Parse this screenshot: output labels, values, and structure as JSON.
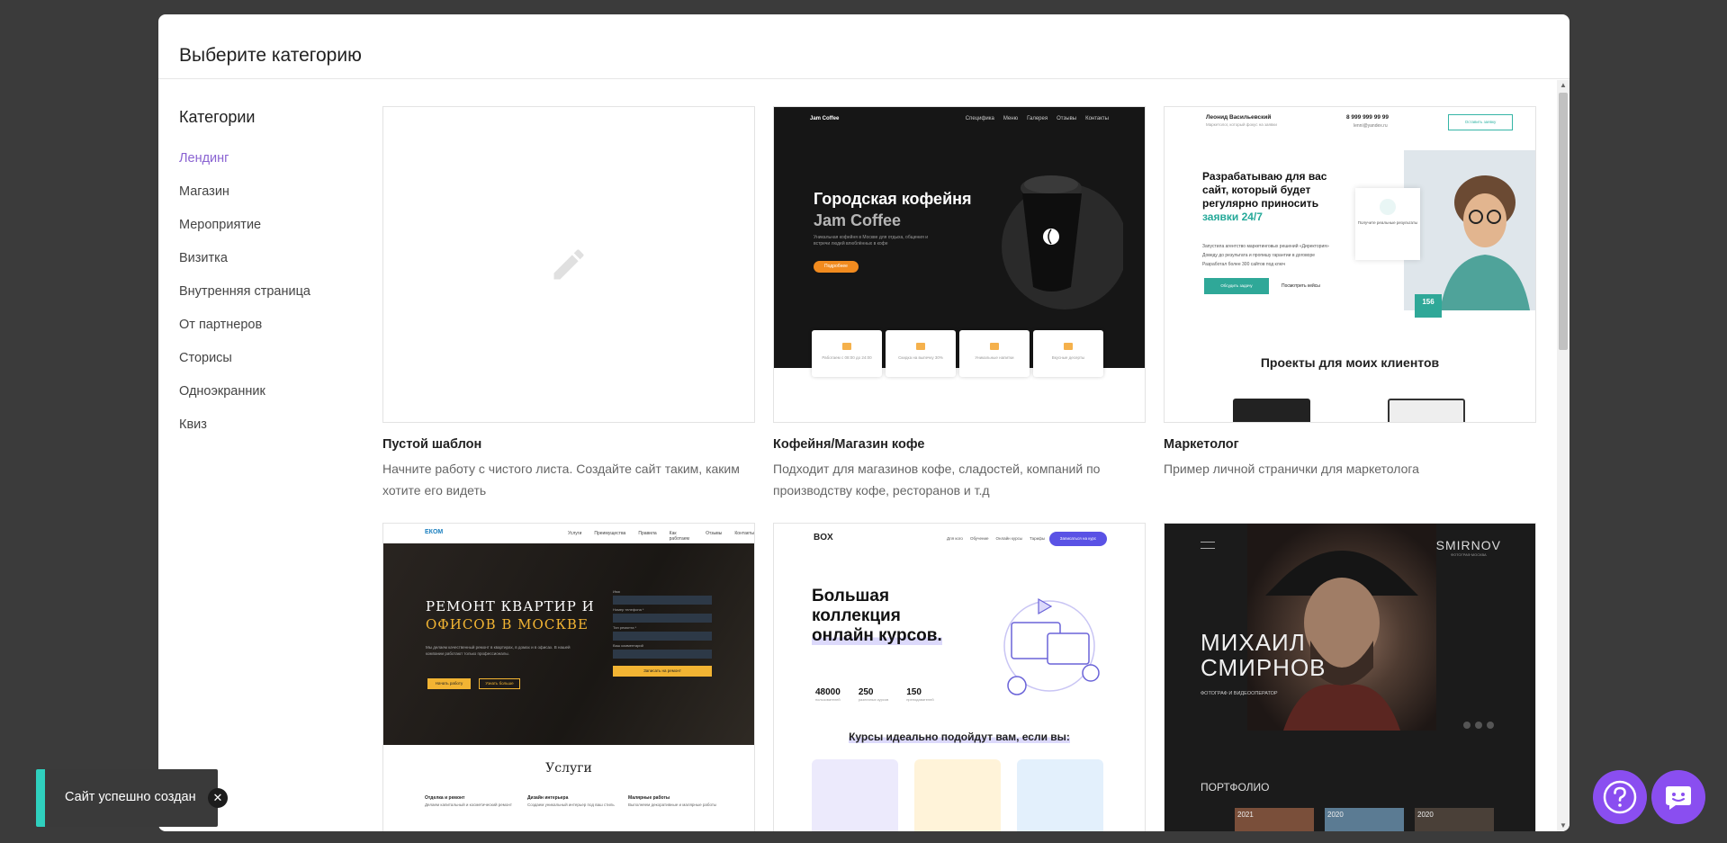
{
  "modal": {
    "title": "Выберите категорию"
  },
  "sidebar": {
    "title": "Категории",
    "items": [
      {
        "label": "Лендинг",
        "active": true
      },
      {
        "label": "Магазин"
      },
      {
        "label": "Мероприятие"
      },
      {
        "label": "Визитка"
      },
      {
        "label": "Внутренняя страница"
      },
      {
        "label": "От партнеров"
      },
      {
        "label": "Сторисы"
      },
      {
        "label": "Одноэкранник"
      },
      {
        "label": "Квиз"
      }
    ]
  },
  "templates": [
    {
      "name": "Пустой шаблон",
      "description": "Начните работу с чистого листа. Создайте сайт таким, каким хотите его видеть",
      "icon": "pencil-icon"
    },
    {
      "name": "Кофейня/Магазин кофе",
      "description": "Подходит для магазинов кофе, сладостей, компаний по производству кофе, ресторанов и т.д",
      "preview": {
        "brand": "Jam Coffee",
        "nav": [
          "Jam Coffee",
          "Специфика",
          "Меню",
          "Галерея",
          "Отзывы",
          "Контакты"
        ],
        "headline": "Городская кофейня",
        "headline_sub": "Jam Coffee",
        "lead": "Уникальная кофейня в Москве для отдыха, общения и встречи людей влюблённых в кофе",
        "button": "Подробнее",
        "features": [
          "Работаем с 08:00 до 24:00",
          "Скидка на выпечку 30%",
          "Уникальные напитки",
          "Вкусные десерты"
        ]
      }
    },
    {
      "name": "Маркетолог",
      "description": "Пример личной странички для маркетолога",
      "preview": {
        "person": "Леонид Васильевский",
        "tagline": "Маркетолог, который фокус на заявки",
        "phone": "8 999 999 99 99",
        "email": "lenni@yandex.ru",
        "cta": "Оставить заявку",
        "headline_1": "Разрабатываю для вас сайт, который будет регулярно приносить",
        "headline_2": "заявки 24/7",
        "bullets": [
          "Запустила агентство маркетинговых решений «Директория»",
          "Доведу до результата и пропишу гарантии в договоре",
          "Разработал более 300 сайтов под ключ"
        ],
        "button": "Обсудить задачу",
        "link": "Посмотреть кейсы",
        "card": "Получите реальные результаты",
        "badge": "156",
        "section": "Проекты для моих клиентов"
      }
    },
    {
      "name": "",
      "description": "",
      "preview": {
        "logo": "ЕКОМ",
        "nav": [
          "Услуги",
          "Преимущества",
          "Правила",
          "Как работаем",
          "Отзывы",
          "Контакты"
        ],
        "headline_1": "РЕМОНТ КВАРТИР И",
        "headline_2": "ОФИСОВ В МОСКВЕ",
        "lead": "Мы делаем качественный ремонт в квартирах, в домах и в офисах. В нашей компании работают только профессионалы.",
        "button_1": "Начать работу",
        "button_2": "Узнать больше",
        "form_labels": [
          "Имя",
          "Номер телефона *",
          "Тип ремонта *",
          "Ваш комментарий"
        ],
        "form_button": "Записать на ремонт",
        "section": "Услуги",
        "services": [
          {
            "title": "Отделка и ремонт",
            "text": "Делаем капитальный и косметический ремонт"
          },
          {
            "title": "Дизайн интерьера",
            "text": "Создаем уникальный интерьер под ваш стиль"
          },
          {
            "title": "Малярные работы",
            "text": "Выполняем декоративные и малярные работы"
          }
        ]
      }
    },
    {
      "name": "",
      "description": "",
      "preview": {
        "logo": "BOX",
        "nav": [
          "Для кого",
          "Обучение",
          "Онлайн курсы",
          "Тарифы"
        ],
        "nav_button": "Записаться на курс",
        "headline_1": "Большая",
        "headline_2": "коллекция",
        "headline_3": "онлайн курсов.",
        "stats": [
          {
            "value": "48000",
            "label": "пользователей"
          },
          {
            "value": "250",
            "label": "различных курсов"
          },
          {
            "value": "150",
            "label": "преподавателей"
          }
        ],
        "section": "Курсы идеально подойдут вам, если вы:"
      }
    },
    {
      "name": "",
      "description": "",
      "preview": {
        "brand": "SMIRNOV",
        "brand_sub": "ФОТОГРАФ МОСКВА",
        "headline_1": "МИХАИЛ",
        "headline_2": "СМИРНОВ",
        "sub": "ФОТОГРАФ И ВИДЕООПЕРАТОР",
        "section": "ПОРТФОЛИО",
        "years": [
          "2021",
          "2020",
          "2020"
        ]
      }
    }
  ],
  "toast": {
    "message": "Сайт успешно создан",
    "close": "✕"
  },
  "colors": {
    "accent": "#8a63d2",
    "toast_bar": "#2fd0be",
    "fab": "#8a4ef0"
  }
}
